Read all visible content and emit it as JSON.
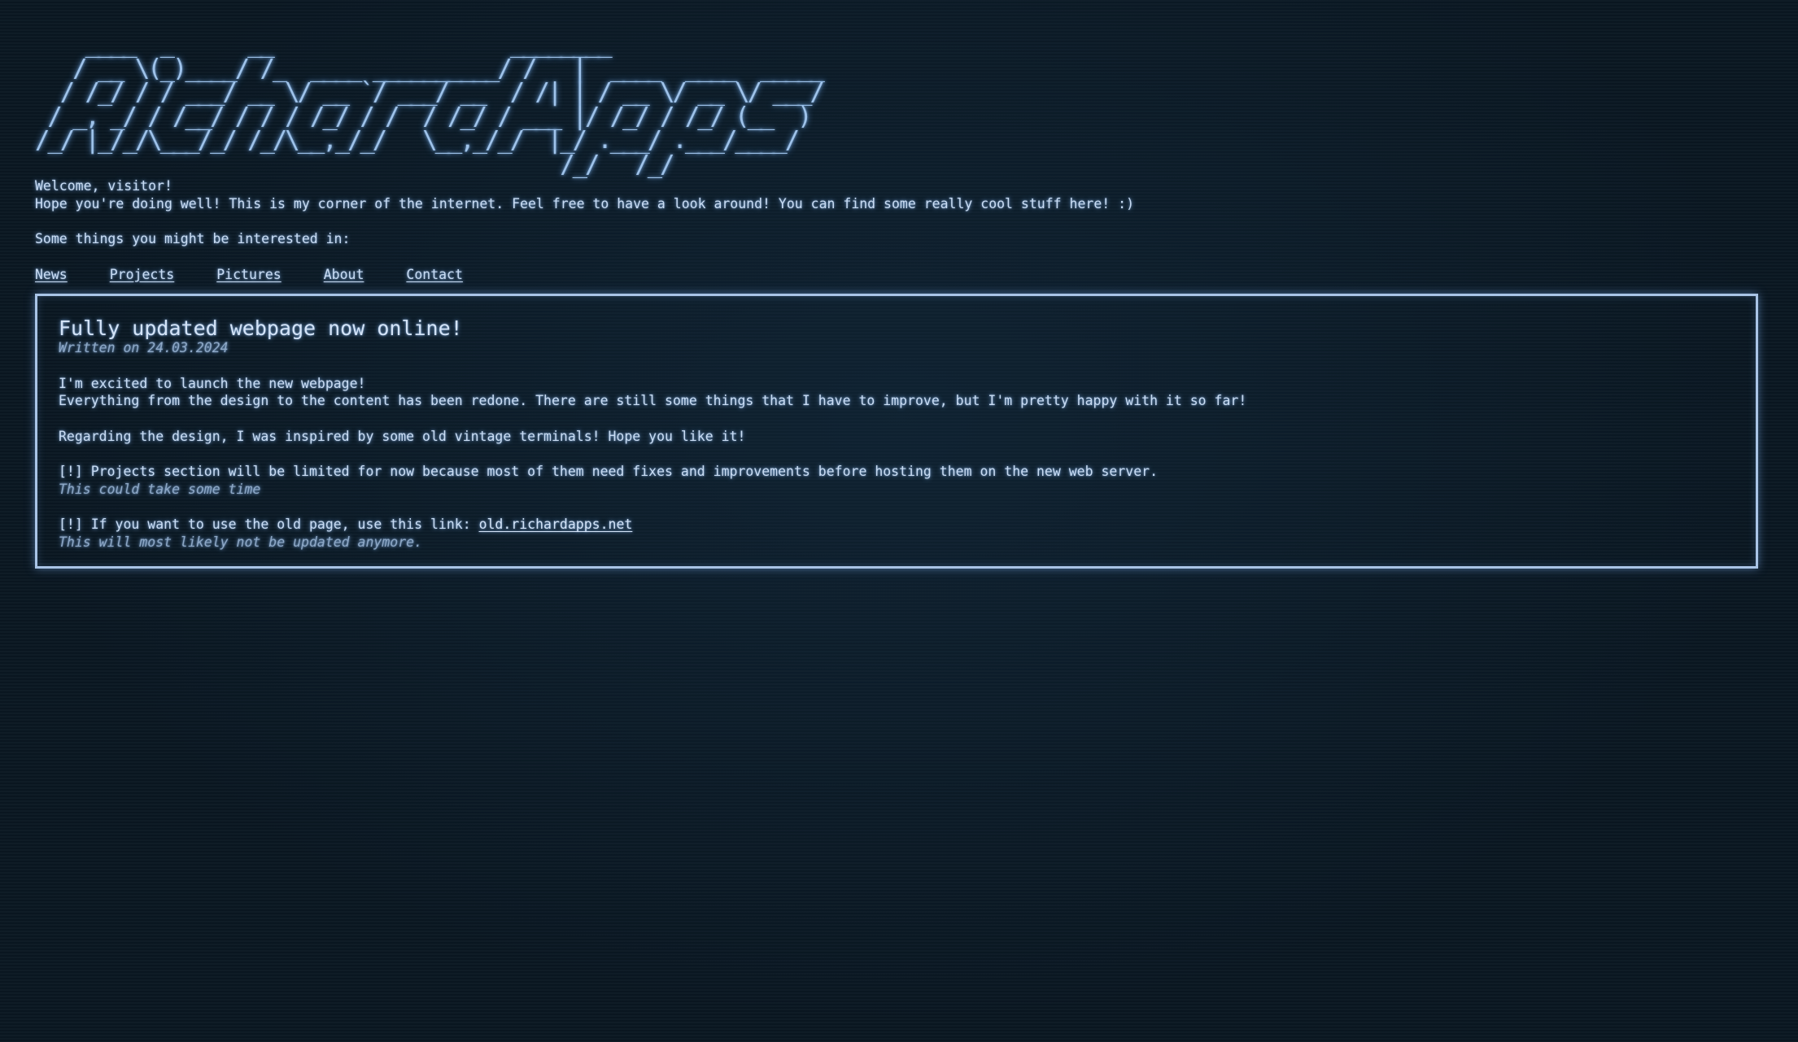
{
  "logo": {
    "ascii": "    ____  _      __                   ________\n   / __ \\(_)____/ /_  ____ __________/ /   |  ____  ____  _____\n  / /_/ / / ___/ __ \\/ __ `/ ___/ __  / /| | / __ \\/ __ \\/ ___/\n / _, _/ / /__/ / / / /_/ / /  / /_/ / ___ |/ /_/ / /_/ (__  )\n/_/ |_/_/\\___/_/ /_/\\__,_/_/   \\__,_/_/  |_/ .___/ .___/____/\n                                          /_/   /_/",
    "text": "RichardApps"
  },
  "intro": {
    "welcome": "Welcome, visitor!",
    "tagline": "Hope you're doing well! This is my corner of the internet. Feel free to have a look around! You can find some really cool stuff here! :)",
    "interested": "Some things you might be interested in:"
  },
  "nav": {
    "items": [
      {
        "label": "News"
      },
      {
        "label": "Projects"
      },
      {
        "label": "Pictures"
      },
      {
        "label": "About"
      },
      {
        "label": "Contact"
      }
    ]
  },
  "post": {
    "title": "Fully updated webpage now online!",
    "date": "Written on 24.03.2024",
    "line1": "I'm excited to launch the new webpage!",
    "line2": "Everything from the design to the content has been redone. There are still some things that I have to improve, but I'm pretty happy with it so far!",
    "line3": "Regarding the design, I was inspired by some old vintage terminals! Hope you like it!",
    "note1": "[!] Projects section will be limited for now because most of them need fixes and improvements before hosting them on the new web server.",
    "note1_sub": "This could take some time",
    "note2_prefix": "[!] If you want to use the old page, use this link: ",
    "note2_link": "old.richardapps.net",
    "note2_sub": "This will most likely not be updated anymore."
  },
  "colors": {
    "background": "#0a1722",
    "text": "#c9dcf3",
    "muted": "#8ea8c6",
    "border": "#a9c4e6",
    "glow": "#82b4f0"
  }
}
